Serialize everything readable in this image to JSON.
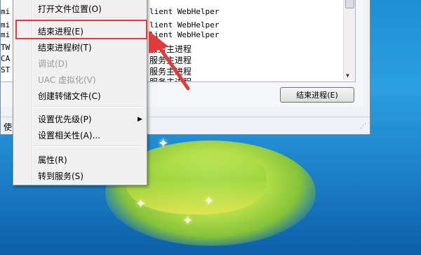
{
  "process_rows": [
    {
      "left": "",
      "desc": ""
    },
    {
      "left": "mi",
      "desc": "lient WebHelper"
    },
    {
      "left": "mi",
      "desc": "lient WebHelper"
    },
    {
      "left": "mi",
      "desc": "lient WebHelper"
    },
    {
      "left": "TW",
      "desc": "服务主进程"
    },
    {
      "left": "CA",
      "desc": "服务主进程"
    },
    {
      "left": "ST",
      "desc": "服务主进程"
    },
    {
      "left": "",
      "desc": "服务主进程"
    }
  ],
  "end_process_button": "结束进程(E)",
  "status_label": "使",
  "context_menu": {
    "items": [
      {
        "label": "打开文件位置(O)",
        "disabled": false
      },
      {
        "label": "结束进程(E)",
        "disabled": false
      },
      {
        "label": "结束进程树(T)",
        "disabled": false
      },
      {
        "label": "调试(D)",
        "disabled": true
      },
      {
        "label": "UAC 虚拟化(V)",
        "disabled": true
      },
      {
        "label": "创建转储文件(C)",
        "disabled": false
      },
      {
        "label": "设置优先级(P)",
        "disabled": false
      },
      {
        "label": "设置相关性(A)...",
        "disabled": false
      },
      {
        "label": "属性(R)",
        "disabled": false
      },
      {
        "label": "转到服务(S)",
        "disabled": false
      }
    ],
    "submenu_arrow": "▶"
  },
  "colors": {
    "highlight_box": "#e23b3b",
    "arrow": "#e23b3b"
  },
  "icons": {
    "scroll_down": "▼",
    "resize_grip": "⋰",
    "sparkle": "✦"
  }
}
